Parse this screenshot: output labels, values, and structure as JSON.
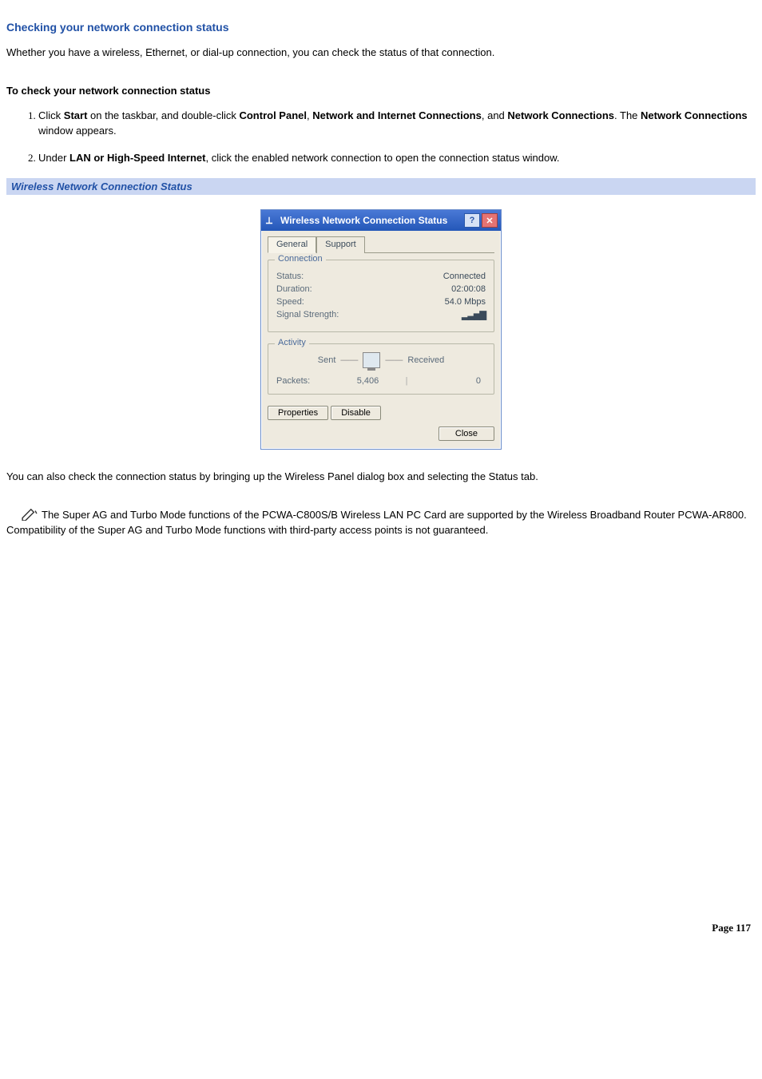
{
  "title": "Checking your network connection status",
  "intro": "Whether you have a wireless, Ethernet, or dial-up connection, you can check the status of that connection.",
  "sub_heading": "To check your network connection status",
  "steps": {
    "s1_a": "Click ",
    "s1_b": "Start",
    "s1_c": " on the taskbar, and double-click ",
    "s1_d": "Control Panel",
    "s1_e": ", ",
    "s1_f": "Network and Internet Connections",
    "s1_g": ", and ",
    "s1_h": "Network Connections",
    "s1_i": ". The ",
    "s1_j": "Network Connections",
    "s1_k": " window appears.",
    "s2_a": "Under ",
    "s2_b": "LAN or High-Speed Internet",
    "s2_c": ", click the enabled network connection to open the connection status window."
  },
  "caption": "Wireless Network Connection Status",
  "dialog": {
    "title": "Wireless Network Connection Status",
    "help_btn": "?",
    "close_btn": "✕",
    "tabs": {
      "general": "General",
      "support": "Support"
    },
    "group_connection": {
      "legend": "Connection",
      "status_label": "Status:",
      "status_value": "Connected",
      "duration_label": "Duration:",
      "duration_value": "02:00:08",
      "speed_label": "Speed:",
      "speed_value": "54.0 Mbps",
      "signal_label": "Signal Strength:",
      "signal_icon": "📶"
    },
    "group_activity": {
      "legend": "Activity",
      "sent_label": "Sent",
      "received_label": "Received",
      "packets_label": "Packets:",
      "packets_sent": "5,406",
      "packets_received": "0"
    },
    "buttons": {
      "properties": "Properties",
      "disable": "Disable",
      "close": "Close"
    }
  },
  "after_text": "You can also check the connection status by bringing up the Wireless Panel dialog box and selecting the Status tab.",
  "note_text": "The Super AG and Turbo Mode functions of the PCWA-C800S/B Wireless LAN PC Card are supported by the Wireless Broadband Router PCWA-AR800. Compatibility of the Super AG and Turbo Mode functions with third-party access points is not guaranteed.",
  "page_number": "Page 117"
}
